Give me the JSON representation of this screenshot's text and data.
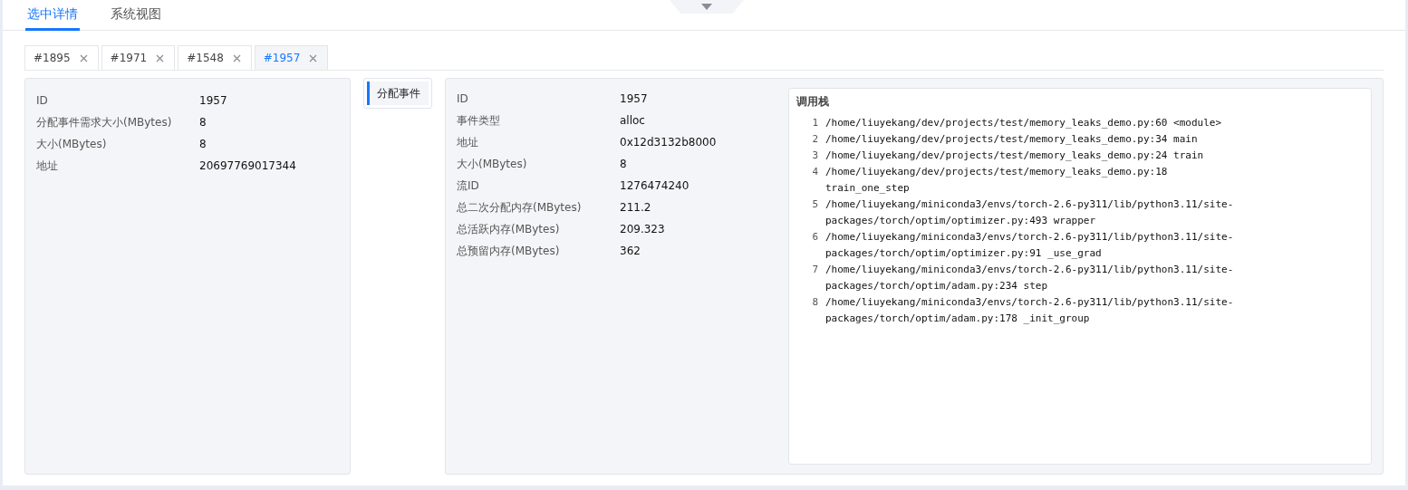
{
  "main_tabs": [
    {
      "label": "选中详情",
      "selected": true
    },
    {
      "label": "系统视图",
      "selected": false
    }
  ],
  "tabs": [
    {
      "label": "#1895",
      "selected": false
    },
    {
      "label": "#1971",
      "selected": false
    },
    {
      "label": "#1548",
      "selected": false
    },
    {
      "label": "#1957",
      "selected": true
    }
  ],
  "block_details": [
    {
      "label": "ID",
      "value": "1957"
    },
    {
      "label": "分配事件需求大小(MBytes)",
      "value": "8"
    },
    {
      "label": "大小(MBytes)",
      "value": "8"
    },
    {
      "label": "地址",
      "value": "20697769017344"
    }
  ],
  "event_nav": [
    {
      "label": "分配事件",
      "selected": true
    }
  ],
  "event_details": [
    {
      "label": "ID",
      "value": "1957"
    },
    {
      "label": "事件类型",
      "value": "alloc"
    },
    {
      "label": "地址",
      "value": "0x12d3132b8000"
    },
    {
      "label": "大小(MBytes)",
      "value": "8"
    },
    {
      "label": "流ID",
      "value": "1276474240"
    },
    {
      "label": "总二次分配内存(MBytes)",
      "value": "211.2"
    },
    {
      "label": "总活跃内存(MBytes)",
      "value": "209.323"
    },
    {
      "label": "总预留内存(MBytes)",
      "value": "362"
    }
  ],
  "call_stack": {
    "title": "调用栈",
    "frames": [
      {
        "index": "1",
        "text": "/home/liuyekang/dev/projects/test/memory_leaks_demo.py:60 <module>"
      },
      {
        "index": "2",
        "text": "/home/liuyekang/dev/projects/test/memory_leaks_demo.py:34 main"
      },
      {
        "index": "3",
        "text": "/home/liuyekang/dev/projects/test/memory_leaks_demo.py:24 train"
      },
      {
        "index": "4",
        "text": "/home/liuyekang/dev/projects/test/memory_leaks_demo.py:18 train_one_step"
      },
      {
        "index": "5",
        "text": "/home/liuyekang/miniconda3/envs/torch-2.6-py311/lib/python3.11/site-packages/torch/optim/optimizer.py:493 wrapper"
      },
      {
        "index": "6",
        "text": "/home/liuyekang/miniconda3/envs/torch-2.6-py311/lib/python3.11/site-packages/torch/optim/optimizer.py:91 _use_grad"
      },
      {
        "index": "7",
        "text": "/home/liuyekang/miniconda3/envs/torch-2.6-py311/lib/python3.11/site-packages/torch/optim/adam.py:234 step"
      },
      {
        "index": "8",
        "text": "/home/liuyekang/miniconda3/envs/torch-2.6-py311/lib/python3.11/site-packages/torch/optim/adam.py:178 _init_group"
      }
    ]
  }
}
